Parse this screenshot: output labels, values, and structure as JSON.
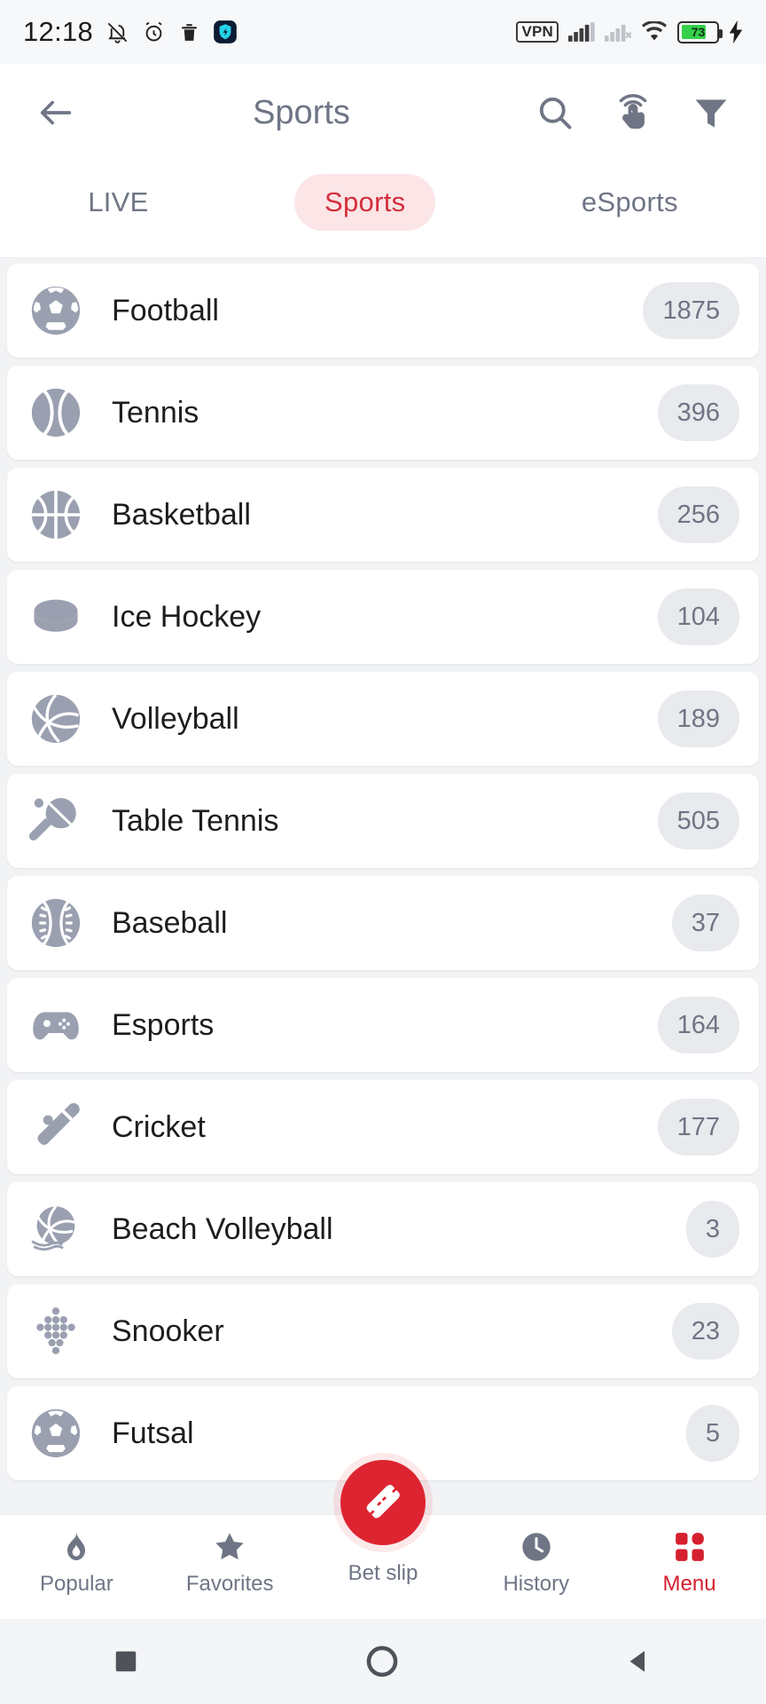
{
  "status_bar": {
    "time": "12:18",
    "icons_left": [
      "notifications-off-icon",
      "alarm-icon",
      "trash-icon",
      "shield-app-icon"
    ],
    "vpn_label": "VPN",
    "icons_right": [
      "signal-icon",
      "signal-off-icon",
      "wifi-icon"
    ],
    "battery_percent": "73",
    "battery_charging": true
  },
  "header": {
    "back_icon": "back-arrow-icon",
    "title": "Sports",
    "actions": [
      {
        "name": "search-icon"
      },
      {
        "name": "tap-gesture-icon"
      },
      {
        "name": "filter-icon"
      }
    ]
  },
  "tabs": {
    "items": [
      {
        "label": "LIVE",
        "active": false
      },
      {
        "label": "Sports",
        "active": true
      },
      {
        "label": "eSports",
        "active": false
      }
    ],
    "active_color": "#d32f3a",
    "active_bg": "#fbe5e7",
    "inactive_color": "#6f7585"
  },
  "sports_list": [
    {
      "icon": "football-icon",
      "label": "Football",
      "count": "1875"
    },
    {
      "icon": "tennis-icon",
      "label": "Tennis",
      "count": "396"
    },
    {
      "icon": "basketball-icon",
      "label": "Basketball",
      "count": "256"
    },
    {
      "icon": "ice-hockey-icon",
      "label": "Ice Hockey",
      "count": "104"
    },
    {
      "icon": "volleyball-icon",
      "label": "Volleyball",
      "count": "189"
    },
    {
      "icon": "table-tennis-icon",
      "label": "Table Tennis",
      "count": "505"
    },
    {
      "icon": "baseball-icon",
      "label": "Baseball",
      "count": "37"
    },
    {
      "icon": "esports-icon",
      "label": "Esports",
      "count": "164"
    },
    {
      "icon": "cricket-icon",
      "label": "Cricket",
      "count": "177"
    },
    {
      "icon": "beach-volleyball-icon",
      "label": "Beach Volleyball",
      "count": "3"
    },
    {
      "icon": "snooker-icon",
      "label": "Snooker",
      "count": "23"
    },
    {
      "icon": "futsal-icon",
      "label": "Futsal",
      "count": "5"
    }
  ],
  "bottom_nav": {
    "items": [
      {
        "label": "Popular",
        "icon": "flame-icon",
        "active": false
      },
      {
        "label": "Favorites",
        "icon": "star-icon",
        "active": false
      },
      {
        "label": "Bet slip",
        "icon": "ticket-icon",
        "active": false,
        "center": true
      },
      {
        "label": "History",
        "icon": "clock-icon",
        "active": false
      },
      {
        "label": "Menu",
        "icon": "grid-icon",
        "active": true
      }
    ],
    "accent_color": "#dd2430"
  },
  "system_nav": {
    "buttons": [
      "recents-square-icon",
      "home-circle-icon",
      "back-triangle-icon"
    ]
  }
}
